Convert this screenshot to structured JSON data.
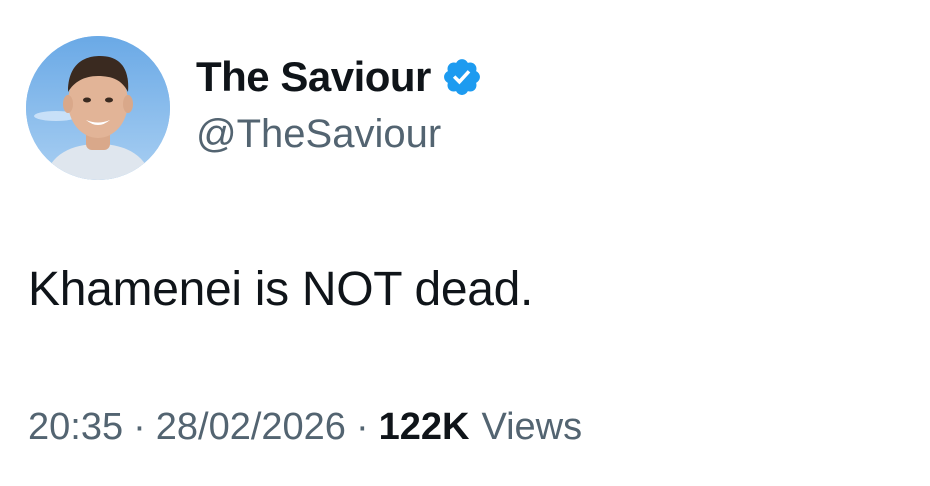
{
  "author": {
    "display_name": "The Saviour",
    "handle": "@TheSaviour",
    "verified": true,
    "avatar_icon": "profile-photo",
    "verified_icon": "verified-badge-icon"
  },
  "tweet": {
    "text": "Khamenei is NOT dead."
  },
  "meta": {
    "time": "20:35",
    "separator": "·",
    "date": "28/02/2026",
    "views_count": "122K",
    "views_label": "Views"
  },
  "colors": {
    "primary_text": "#0f1419",
    "secondary_text": "#536471",
    "verified_blue": "#1d9bf0",
    "background": "#ffffff"
  }
}
